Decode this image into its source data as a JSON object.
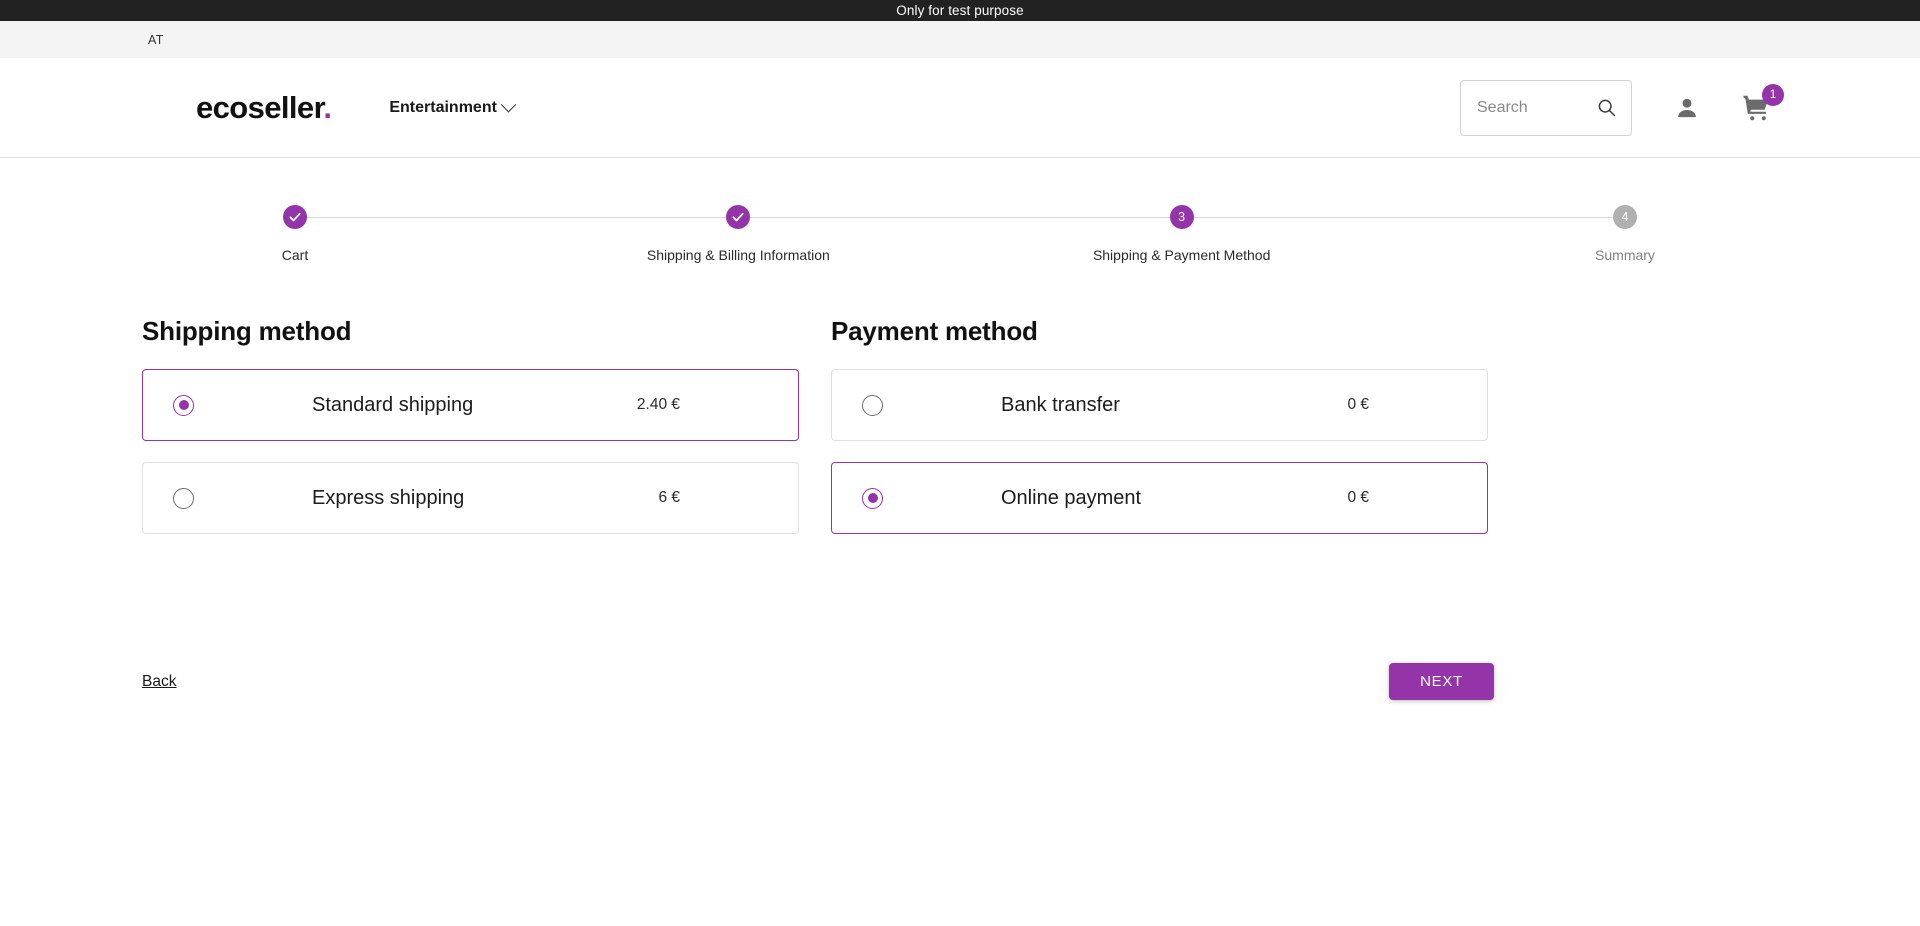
{
  "banner": {
    "text": "Only for test purpose"
  },
  "region": {
    "code": "AT"
  },
  "header": {
    "logo_text": "ecoseller",
    "logo_dot": ".",
    "category_label": "Entertainment",
    "chevron_icon": "chevron-down-icon",
    "search": {
      "placeholder": "Search",
      "value": "",
      "icon": "search-icon"
    },
    "account_icon": "person-icon",
    "cart_icon": "cart-icon",
    "cart_count": "1"
  },
  "stepper": {
    "steps": [
      {
        "label": "Cart",
        "marker": "✓",
        "state": "complete"
      },
      {
        "label": "Shipping & Billing Information",
        "marker": "✓",
        "state": "complete"
      },
      {
        "label": "Shipping & Payment Method",
        "marker": "3",
        "state": "active"
      },
      {
        "label": "Summary",
        "marker": "4",
        "state": "upcoming"
      }
    ]
  },
  "shipping": {
    "title": "Shipping method",
    "options": [
      {
        "label": "Standard shipping",
        "price": "2.40 €",
        "selected": true
      },
      {
        "label": "Express shipping",
        "price": "6 €",
        "selected": false
      }
    ]
  },
  "payment": {
    "title": "Payment method",
    "options": [
      {
        "label": "Bank transfer",
        "price": "0 €",
        "selected": false
      },
      {
        "label": "Online payment",
        "price": "0 €",
        "selected": true
      }
    ]
  },
  "actions": {
    "back_label": "Back",
    "next_label": "NEXT"
  },
  "colors": {
    "accent": "#9334a8",
    "banner_bg": "#222222",
    "strip_bg": "#f4f4f4",
    "inactive_step": "#b0b0b0"
  }
}
